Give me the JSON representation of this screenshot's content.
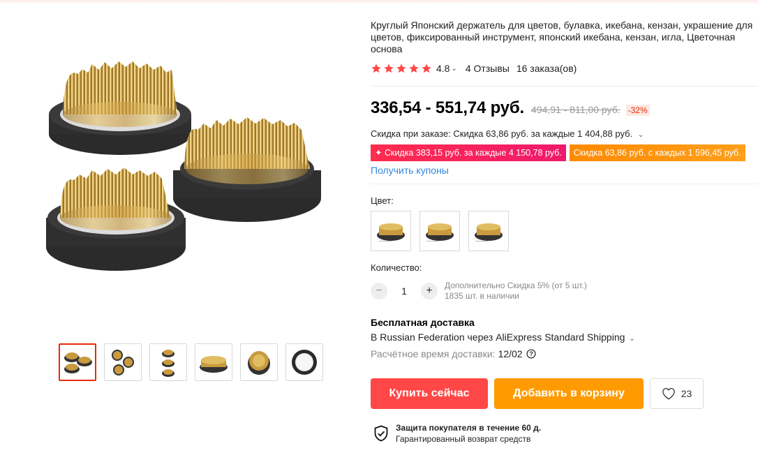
{
  "product": {
    "title": "Круглый Японский держатель для цветов, булавка, икебана, кензан, украшение для цветов, фиксированный инструмент, японский икебана, кензан, игла, Цветочная основа",
    "rating": "4.8",
    "reviews": "4 Отзывы",
    "orders": "16 заказа(ов)",
    "price": "336,54 - 551,74 руб.",
    "old_price": "494,91 - 811,00 руб.",
    "discount": "-32%",
    "order_discount": "Скидка при заказе: Скидка 63,86 руб. за каждые 1 404,88 руб.",
    "coupon_1": "✦ Скидка 383,15 руб. за каждые 4 150,78 руб.",
    "coupon_2": "Скидка 63,86 руб. с каждых 1 596,45 руб.",
    "get_coupons": "Получить купоны"
  },
  "options": {
    "color_label": "Цвет:",
    "quantity_label": "Количество:",
    "quantity": "1",
    "qty_info_1": "Дополнительно Скидка 5% (от 5 шт.)",
    "qty_info_2": "1835 шт. в наличии"
  },
  "shipping": {
    "title": "Бесплатная доставка",
    "line": "В Russian Federation через AliExpress Standard Shipping",
    "eta_label": "Расчётное время доставки:",
    "eta_value": "12/02"
  },
  "actions": {
    "buy": "Купить сейчас",
    "cart": "Добавить в корзину",
    "wishlist_count": "23"
  },
  "protection": {
    "title": "Защита покупателя в течение 60 д.",
    "subtitle": "Гарантированный возврат средств"
  },
  "colors": {
    "star": "#ff4747",
    "buy": "#ff4747",
    "cart": "#ff9a00",
    "link": "#2e86de"
  }
}
